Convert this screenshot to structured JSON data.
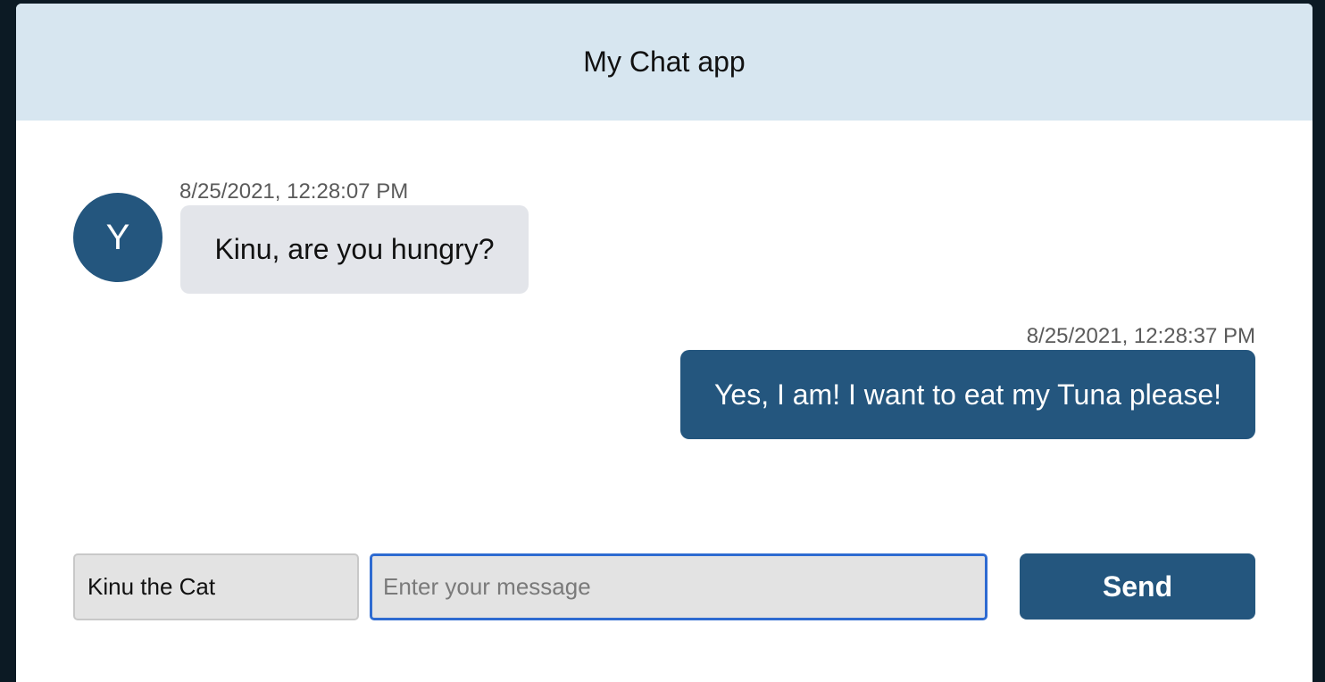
{
  "app": {
    "title": "My Chat app"
  },
  "messages": [
    {
      "sender_initial": "Y",
      "timestamp": "8/25/2021, 12:28:07 PM",
      "text": "Kinu, are you hungry?",
      "direction": "received"
    },
    {
      "timestamp": "8/25/2021, 12:28:37 PM",
      "text": "Yes, I am! I want to eat my Tuna please!",
      "direction": "sent"
    }
  ],
  "composer": {
    "name_value": "Kinu the Cat",
    "message_value": "",
    "message_placeholder": "Enter your message",
    "send_label": "Send"
  },
  "colors": {
    "header_bg": "#d7e6f0",
    "accent": "#24567e",
    "received_bubble": "#e3e5ea",
    "focus_border": "#2e6bd1"
  }
}
